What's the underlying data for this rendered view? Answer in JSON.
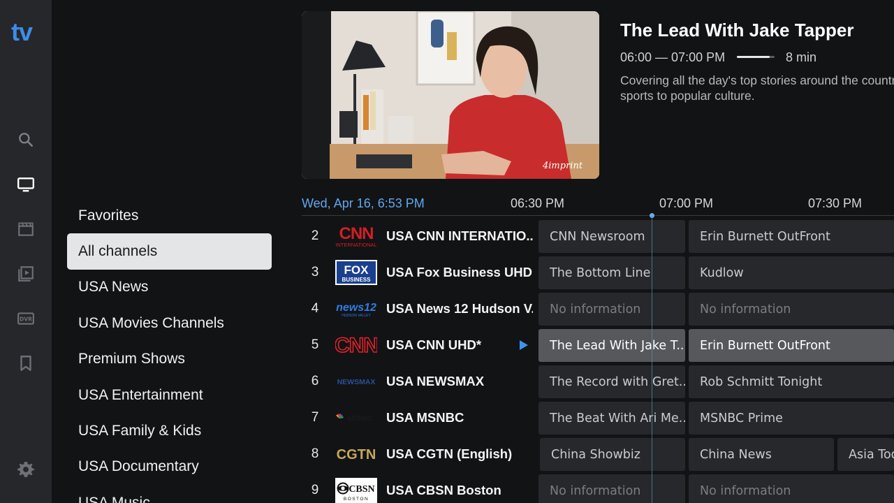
{
  "app": {
    "logo": "tv"
  },
  "nav": [
    {
      "icon": "search-icon"
    },
    {
      "icon": "tv-icon"
    },
    {
      "icon": "movie-clapper-icon"
    },
    {
      "icon": "video-library-icon"
    },
    {
      "icon": "dvr-icon",
      "label": "DVR"
    },
    {
      "icon": "bookmark-icon"
    },
    {
      "icon": "settings-gear-icon"
    }
  ],
  "categories": [
    {
      "label": "Favorites"
    },
    {
      "label": "All channels",
      "selected": true
    },
    {
      "label": "USA News"
    },
    {
      "label": "USA Movies Channels"
    },
    {
      "label": "Premium Shows"
    },
    {
      "label": "USA Entertainment"
    },
    {
      "label": "USA Family & Kids"
    },
    {
      "label": "USA Documentary"
    },
    {
      "label": "USA Music"
    }
  ],
  "preview": {
    "watermark": "4imprint"
  },
  "current_program": {
    "title": "The Lead With Jake Tapper",
    "time_range": "06:00 — 07:00 PM",
    "progress": 0.87,
    "remaining": "8 min",
    "description_line1": "Covering all the day's top stories around the country and the world, from politics to",
    "description_line2": "sports to popular culture."
  },
  "timeline": {
    "date": "Wed, Apr 16, 6:53 PM",
    "ticks": [
      "06:30 PM",
      "07:00 PM",
      "07:30 PM"
    ]
  },
  "channels": [
    {
      "number": "2",
      "name": "USA CNN INTERNATIO..",
      "logo": "CNN INTERNATIONAL",
      "programs": [
        {
          "title": "CNN Newsroom"
        },
        {
          "title": "Erin Burnett OutFront"
        }
      ]
    },
    {
      "number": "3",
      "name": "USA Fox Business UHD",
      "logo": "FOX BUSINESS",
      "programs": [
        {
          "title": "The Bottom Line"
        },
        {
          "title": "Kudlow"
        }
      ]
    },
    {
      "number": "4",
      "name": "USA News 12 Hudson V..",
      "logo": "news12",
      "programs": [
        {
          "title": "No information",
          "noinfo": true
        },
        {
          "title": "No information",
          "noinfo": true
        }
      ]
    },
    {
      "number": "5",
      "name": "USA CNN UHD*",
      "logo": "CNN",
      "playing": true,
      "programs": [
        {
          "title": "The Lead With Jake T...",
          "active": true
        },
        {
          "title": "Erin Burnett OutFront",
          "active": true
        }
      ]
    },
    {
      "number": "6",
      "name": "USA NEWSMAX",
      "logo": "NEWSMAX TV",
      "programs": [
        {
          "title": "The Record with Gret..."
        },
        {
          "title": "Rob Schmitt Tonight"
        }
      ]
    },
    {
      "number": "7",
      "name": "USA MSNBC",
      "logo": "MSNBC",
      "programs": [
        {
          "title": "The Beat With Ari Me..."
        },
        {
          "title": "MSNBC Prime"
        }
      ]
    },
    {
      "number": "8",
      "name": "USA CGTN (English)",
      "logo": "CGTN",
      "programs": [
        {
          "title": "China Showbiz"
        },
        {
          "title": "China News"
        },
        {
          "title": "Asia Today"
        }
      ]
    },
    {
      "number": "9",
      "name": "USA CBSN Boston",
      "logo": "CBSN BOSTON",
      "programs": [
        {
          "title": "No information",
          "noinfo": true
        },
        {
          "title": "No information",
          "noinfo": true
        }
      ]
    }
  ],
  "colors": {
    "accent": "#3b95ee",
    "date": "#5fa8ee",
    "rail": "#25272a",
    "background": "#121315"
  }
}
